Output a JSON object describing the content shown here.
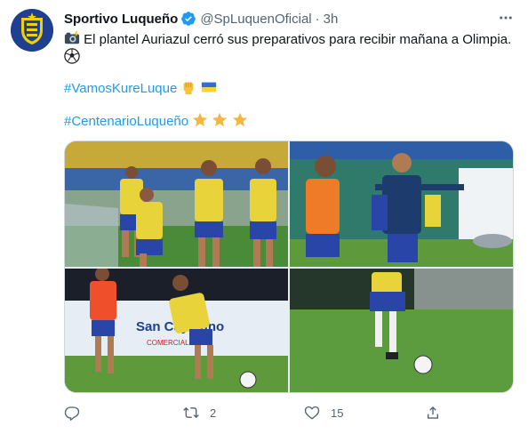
{
  "author": {
    "display_name": "Sportivo Luqueño",
    "handle": "@SpLuquenOficial",
    "separator": "·",
    "time": "3h",
    "verified": true,
    "avatar_icon": "club-crest-icon"
  },
  "tweet": {
    "line1_emoji": "camera-flash-icon",
    "line1_text": "El plantel Auriazul cerró sus preparativos para recibir mañana a Olimpia.",
    "line2_emoji": "soccer-ball-icon",
    "hashtag1": "#VamosKureLuque",
    "hashtag1_emojis": [
      "raised-fist-icon",
      "ukraine-flag-icon"
    ],
    "hashtag2": "#CentenarioLuqueño",
    "hashtag2_emojis": [
      "star-icon",
      "star-icon",
      "star-icon"
    ]
  },
  "media": {
    "photos": [
      {
        "name": "training-photo-1",
        "alt": "Jugadores con petos amarillos entrenando"
      },
      {
        "name": "training-photo-2",
        "alt": "Entrenador dando indicaciones a jugadores"
      },
      {
        "name": "training-photo-3",
        "alt": "Jugadores disputando el balón frente a cartel San Cayetano"
      },
      {
        "name": "training-photo-4",
        "alt": "Jugador conduciendo el balón en el campo"
      }
    ],
    "banner_text": "San Cayetano",
    "banner_sub": "COMERCIAL"
  },
  "actions": {
    "reply_count": "",
    "retweet_count": "2",
    "like_count": "15",
    "share_count": ""
  },
  "colors": {
    "accent": "#1d9bf0",
    "secondary_text": "#536471",
    "club_blue": "#1f3f8f",
    "club_yellow": "#f5d000"
  }
}
